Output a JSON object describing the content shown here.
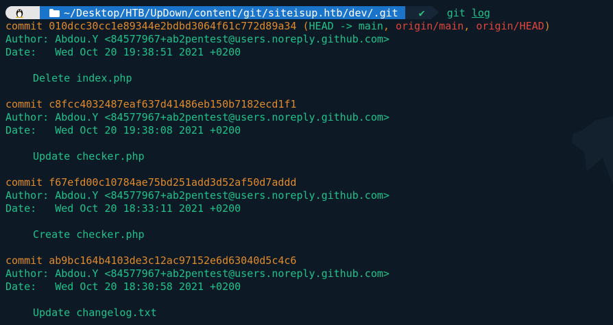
{
  "prompt": {
    "os_icon": "linux-penguin-icon",
    "path": "~/Desktop/HTB/UpDown/content/git/siteisup.htb/dev/.git",
    "status": "✔",
    "command": "git",
    "command_arg": "log"
  },
  "log": [
    {
      "commit_label": "commit",
      "hash": "010dcc30cc1e89344e2bdbd3064f61c772d89a34",
      "refs": {
        "head": "HEAD -> main",
        "origin_main": "origin/main",
        "origin_head": "origin/HEAD"
      },
      "author_label": "Author:",
      "author": "Abdou.Y <84577967+ab2pentest@users.noreply.github.com>",
      "date_label": "Date:",
      "date": "Wed Oct 20 19:38:51 2021 +0200",
      "message": "Delete index.php"
    },
    {
      "commit_label": "commit",
      "hash": "c8fcc4032487eaf637d41486eb150b7182ecd1f1",
      "author_label": "Author:",
      "author": "Abdou.Y <84577967+ab2pentest@users.noreply.github.com>",
      "date_label": "Date:",
      "date": "Wed Oct 20 19:38:08 2021 +0200",
      "message": "Update checker.php"
    },
    {
      "commit_label": "commit",
      "hash": "f67efd00c10784ae75bd251add3d52af50d7addd",
      "author_label": "Author:",
      "author": "Abdou.Y <84577967+ab2pentest@users.noreply.github.com>",
      "date_label": "Date:",
      "date": "Wed Oct 20 18:33:11 2021 +0200",
      "message": "Create checker.php"
    },
    {
      "commit_label": "commit",
      "hash": "ab9bc164b4103de3c12ac97152e6d63040d5c4c6",
      "author_label": "Author:",
      "author": "Abdou.Y <84577967+ab2pentest@users.noreply.github.com>",
      "date_label": "Date:",
      "date": "Wed Oct 20 18:30:58 2021 +0200",
      "message": "Update changelog.txt"
    }
  ],
  "colors": {
    "background": "#0d1a26",
    "text_green": "#1fc28a",
    "commit_orange": "#e08a2c",
    "origin_red": "#e0453a",
    "path_segment_blue": "#1a74c9"
  }
}
